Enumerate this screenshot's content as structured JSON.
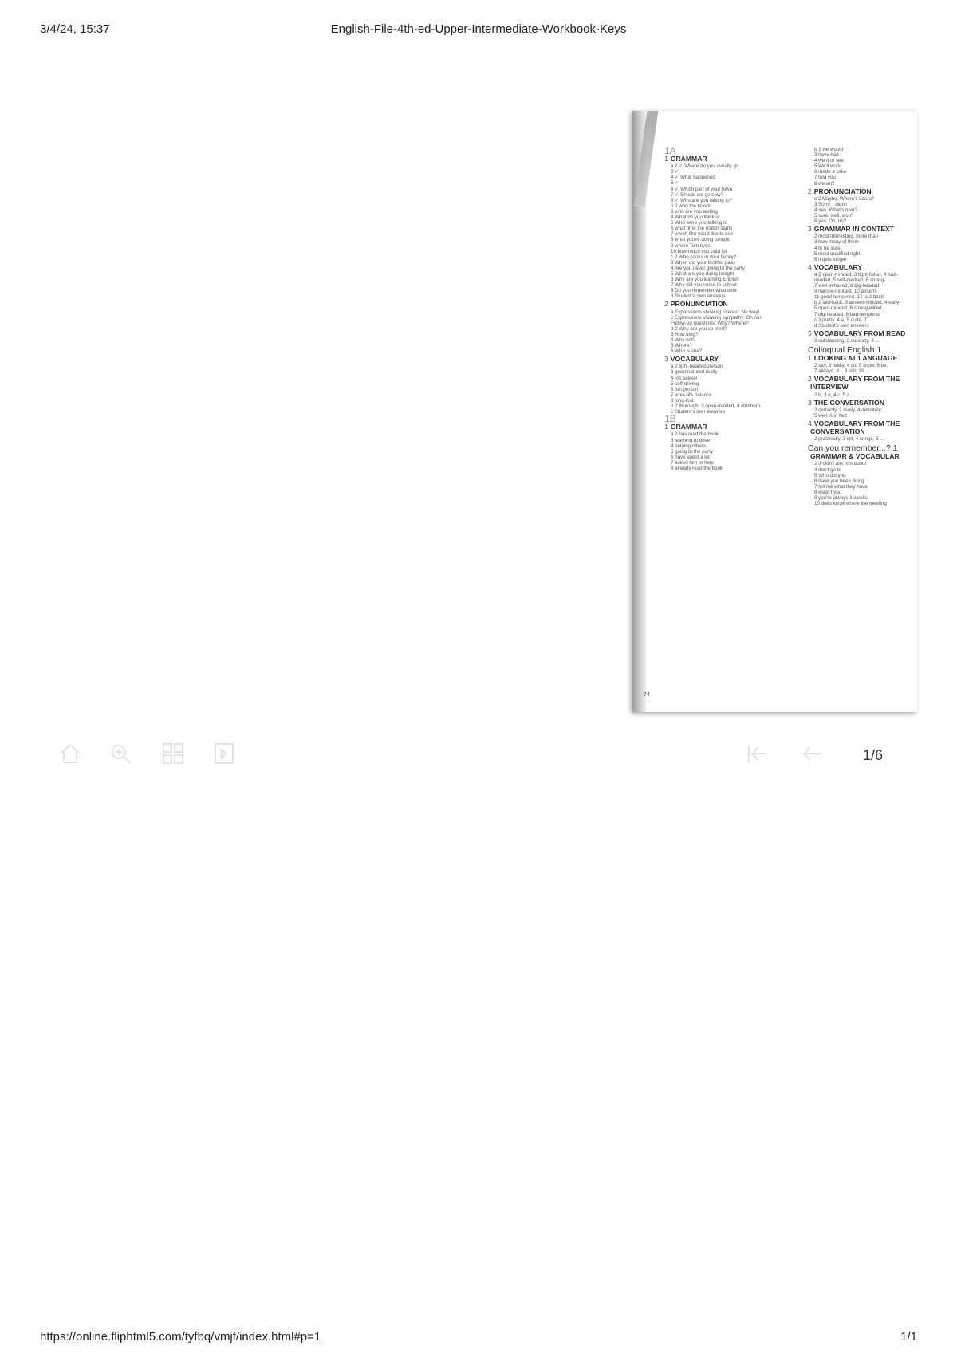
{
  "print_header": {
    "date": "3/4/24, 15:37",
    "title": "English-File-4th-ed-Upper-Intermediate-Workbook-Keys"
  },
  "print_footer": {
    "url": "https://online.fliphtml5.com/tyfbq/vmjf/index.html#p=1",
    "pages": "1/1"
  },
  "book_page": {
    "page_number": "74",
    "left_column": [
      {
        "type": "unit",
        "text": "1A"
      },
      {
        "type": "section",
        "num": "1",
        "text": "GRAMMAR"
      },
      {
        "type": "line",
        "text": "a  2  ✓ Where do you usually go"
      },
      {
        "type": "line",
        "text": "3  ✓"
      },
      {
        "type": "line",
        "text": "4  ✓ What happened"
      },
      {
        "type": "line",
        "text": "5  ✓"
      },
      {
        "type": "line",
        "text": "6  ✓ Which part of your town"
      },
      {
        "type": "line",
        "text": "7  ✓ Should we go now?"
      },
      {
        "type": "line",
        "text": "8  ✓ Who are you talking to?"
      },
      {
        "type": "line",
        "text": "b  2  who the tickets"
      },
      {
        "type": "line",
        "text": "3  who are you texting"
      },
      {
        "type": "line",
        "text": "4  What do you think of"
      },
      {
        "type": "line",
        "text": "5  Who were you talking to"
      },
      {
        "type": "line",
        "text": "6  what time the match starts"
      },
      {
        "type": "line",
        "text": "7  which film you'd like to see"
      },
      {
        "type": "line",
        "text": "8  what you're doing tonight"
      },
      {
        "type": "line",
        "text": "9  where Tom lives"
      },
      {
        "type": "line",
        "text": "10  how much you paid for"
      },
      {
        "type": "line",
        "text": "c  2  Who cooks in your family?"
      },
      {
        "type": "line",
        "text": "3  When did your brother pass"
      },
      {
        "type": "line",
        "text": "4  Are you never going to the party"
      },
      {
        "type": "line",
        "text": "5  What are you doing tonight"
      },
      {
        "type": "line",
        "text": "6  Why are you learning English"
      },
      {
        "type": "line",
        "text": "7  Why did you come to school"
      },
      {
        "type": "line",
        "text": "8  Do you remember what time"
      },
      {
        "type": "line",
        "text": "d  Student's own answers"
      },
      {
        "type": "section",
        "num": "2",
        "text": "PRONUNCIATION"
      },
      {
        "type": "line",
        "text": "a  Expressions showing interest: No way!"
      },
      {
        "type": "line",
        "text": "c  Expressions showing sympathy: Oh no!"
      },
      {
        "type": "line",
        "text": "Follow-up questions: Why? Where?"
      },
      {
        "type": "line",
        "text": "d  2  Why are you so tired?"
      },
      {
        "type": "line",
        "text": "3  How long?"
      },
      {
        "type": "line",
        "text": "4  Why not?"
      },
      {
        "type": "line",
        "text": "5  Where?"
      },
      {
        "type": "line",
        "text": "6  Who is she?"
      },
      {
        "type": "section",
        "num": "3",
        "text": "VOCABULARY"
      },
      {
        "type": "line",
        "text": "a  2  light-hearted person"
      },
      {
        "type": "line",
        "text": "3  good-natured really"
      },
      {
        "type": "line",
        "text": "4  job seeker"
      },
      {
        "type": "line",
        "text": "5  self-driving"
      },
      {
        "type": "line",
        "text": "6  fun person"
      },
      {
        "type": "line",
        "text": "7  work-life balance"
      },
      {
        "type": "line",
        "text": "8  long-lost"
      },
      {
        "type": "line",
        "text": "b  2  thorough, 3 open-minded, 4 stubborn"
      },
      {
        "type": "line",
        "text": "c  Student's own answers"
      },
      {
        "type": "unit",
        "text": "1B"
      },
      {
        "type": "section",
        "num": "1",
        "text": "GRAMMAR"
      },
      {
        "type": "line",
        "text": "a  2  has read the book"
      },
      {
        "type": "line",
        "text": "3  learning to drive"
      },
      {
        "type": "line",
        "text": "4  helping others"
      },
      {
        "type": "line",
        "text": "5  going to the party"
      },
      {
        "type": "line",
        "text": "6  have spent a lot"
      },
      {
        "type": "line",
        "text": "7  asked him to help"
      },
      {
        "type": "line",
        "text": "8  already read the book"
      }
    ],
    "right_column": [
      {
        "type": "line",
        "text": "b  2  we would"
      },
      {
        "type": "line",
        "text": "3  have had"
      },
      {
        "type": "line",
        "text": "4  went to see"
      },
      {
        "type": "line",
        "text": "5  We'll work"
      },
      {
        "type": "line",
        "text": "6  made a cake"
      },
      {
        "type": "line",
        "text": "7  told you"
      },
      {
        "type": "line",
        "text": "8  weren't"
      },
      {
        "type": "section",
        "num": "2",
        "text": "PRONUNCIATION"
      },
      {
        "type": "line",
        "text": "c  2  Maybe, Where's Laura?"
      },
      {
        "type": "line",
        "text": "3  Sorry, I didn't"
      },
      {
        "type": "line",
        "text": "4  Yes, What's next?"
      },
      {
        "type": "line",
        "text": "5  sure, well, won't"
      },
      {
        "type": "line",
        "text": "6  yes, Oh, no?"
      },
      {
        "type": "section",
        "num": "3",
        "text": "GRAMMAR IN CONTEXT"
      },
      {
        "type": "line",
        "text": "2  most interesting, more than"
      },
      {
        "type": "line",
        "text": "3  how many of them"
      },
      {
        "type": "line",
        "text": "4  to be sure"
      },
      {
        "type": "line",
        "text": "5  most qualified right"
      },
      {
        "type": "line",
        "text": "6  it gets longer"
      },
      {
        "type": "section",
        "num": "4",
        "text": "VOCABULARY"
      },
      {
        "type": "line",
        "text": "a  2 open-minded, 3 tight-fisted, 4 bad-"
      },
      {
        "type": "line",
        "text": "minded, 5 self-centred, 6 strong-"
      },
      {
        "type": "line",
        "text": "7 well-behaved, 8 big-headed"
      },
      {
        "type": "line",
        "text": "9 narrow-minded, 10 absent-"
      },
      {
        "type": "line",
        "text": "11 good-tempered, 12 laid-back"
      },
      {
        "type": "line",
        "text": "b  2 laid-back, 3 absent-minded, 4 easy-"
      },
      {
        "type": "line",
        "text": "5 open-minded, 6 strong-willed,"
      },
      {
        "type": "line",
        "text": "7 big-headed, 8 bad-tempered"
      },
      {
        "type": "line",
        "text": "c  3 pretty, 4 a, 5 quite, 7 ..."
      },
      {
        "type": "line",
        "text": "d  Student's own answers"
      },
      {
        "type": "section",
        "num": "5",
        "text": "VOCABULARY FROM READ"
      },
      {
        "type": "line",
        "text": "2  outstanding, 3 curiosity, 4 ..."
      },
      {
        "type": "part",
        "text": "Colloquial English 1"
      },
      {
        "type": "section",
        "num": "1",
        "text": "LOOKING AT LANGUAGE"
      },
      {
        "type": "line",
        "text": "2 say, 3 really, 4 so, 5 show, 6 be,"
      },
      {
        "type": "line",
        "text": "7 always, 8 I, 9 still, 10 ..."
      },
      {
        "type": "section",
        "num": "2",
        "text": "VOCABULARY FROM THE"
      },
      {
        "type": "section",
        "num": "",
        "text": "INTERVIEW"
      },
      {
        "type": "line",
        "text": "2 b, 3 e, 4 c, 5 a"
      },
      {
        "type": "section",
        "num": "3",
        "text": "THE CONVERSATION"
      },
      {
        "type": "line",
        "text": "2 certainly, 3 really, 4 definitely,"
      },
      {
        "type": "line",
        "text": "5 well, 6 in fact"
      },
      {
        "type": "section",
        "num": "4",
        "text": "VOCABULARY FROM THE"
      },
      {
        "type": "section",
        "num": "",
        "text": "CONVERSATION"
      },
      {
        "type": "line",
        "text": "2 practically, 3 wit, 4 cringe, 5 ..."
      },
      {
        "type": "part",
        "text": "Can you remember...? 1"
      },
      {
        "type": "section",
        "num": "",
        "text": "GRAMMAR & VOCABULAR"
      },
      {
        "type": "line",
        "text": "2  3  didn't ask him about"
      },
      {
        "type": "line",
        "text": "4  don't go to"
      },
      {
        "type": "line",
        "text": "5  Who did you"
      },
      {
        "type": "line",
        "text": "6  have you been doing"
      },
      {
        "type": "line",
        "text": "7  tell me what they have"
      },
      {
        "type": "line",
        "text": "8  wasn't you"
      },
      {
        "type": "line",
        "text": "9  you're always 3 weeks"
      },
      {
        "type": "line",
        "text": "10  does know where the meeting"
      }
    ]
  },
  "toolbar": {
    "icons": [
      "home-icon",
      "zoom-in-icon",
      "grid-icon",
      "play-icon",
      "first-page-icon",
      "previous-page-icon"
    ],
    "page_indicator": "1/6",
    "icon_color": "#e3e3e3"
  }
}
